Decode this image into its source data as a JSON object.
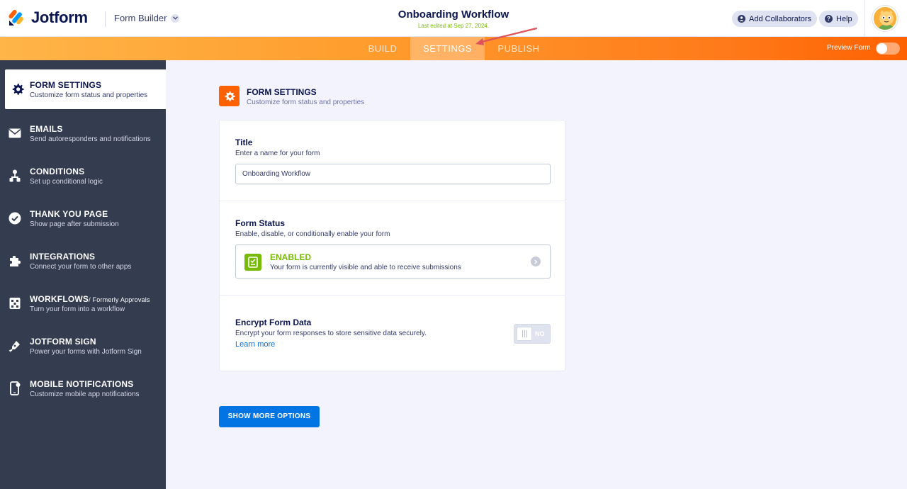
{
  "header": {
    "brand": "Jotform",
    "builder_menu": "Form Builder",
    "form_title": "Onboarding Workflow",
    "last_edited": "Last edited at Sep 27, 2024.",
    "collaborators_label": "Add Collaborators",
    "help_label": "Help"
  },
  "nav": {
    "tabs": [
      {
        "label": "BUILD"
      },
      {
        "label": "SETTINGS"
      },
      {
        "label": "PUBLISH"
      }
    ],
    "active_tab": "SETTINGS",
    "preview_label": "Preview Form"
  },
  "sidebar": {
    "items": [
      {
        "title": "FORM SETTINGS",
        "sub": "Customize form status and properties",
        "icon": "gear-icon"
      },
      {
        "title": "EMAILS",
        "sub": "Send autoresponders and notifications",
        "icon": "envelope-icon"
      },
      {
        "title": "CONDITIONS",
        "sub": "Set up conditional logic",
        "icon": "conditions-icon"
      },
      {
        "title": "THANK YOU PAGE",
        "sub": "Show page after submission",
        "icon": "check-circle-icon"
      },
      {
        "title": "INTEGRATIONS",
        "sub": "Connect your form to other apps",
        "icon": "puzzle-icon"
      },
      {
        "title": "WORKFLOWS",
        "title_suffix": "/ Formerly Approvals",
        "sub": "Turn your form into a workflow",
        "icon": "workflow-icon"
      },
      {
        "title": "JOTFORM SIGN",
        "sub": "Power your forms with Jotform Sign",
        "icon": "pen-icon"
      },
      {
        "title": "MOBILE NOTIFICATIONS",
        "sub": "Customize mobile app notifications",
        "icon": "mobile-icon"
      }
    ]
  },
  "main": {
    "section_title": "FORM SETTINGS",
    "section_sub": "Customize form status and properties",
    "title_field": {
      "label": "Title",
      "desc": "Enter a name for your form",
      "value": "Onboarding Workflow"
    },
    "status": {
      "label": "Form Status",
      "desc": "Enable, disable, or conditionally enable your form",
      "state": "ENABLED",
      "state_desc": "Your form is currently visible and able to receive submissions"
    },
    "encrypt": {
      "label": "Encrypt Form Data",
      "desc": "Encrypt your form responses to store sensitive data securely.",
      "link": "Learn more",
      "toggle_value": "NO"
    },
    "more_button": "SHOW MORE OPTIONS"
  },
  "colors": {
    "brand_orange": "#ff6100",
    "sidebar_bg": "#343c4f",
    "enabled_green": "#78bb07",
    "primary_blue": "#0075e3",
    "annotation_arrow": "#e0525a"
  }
}
